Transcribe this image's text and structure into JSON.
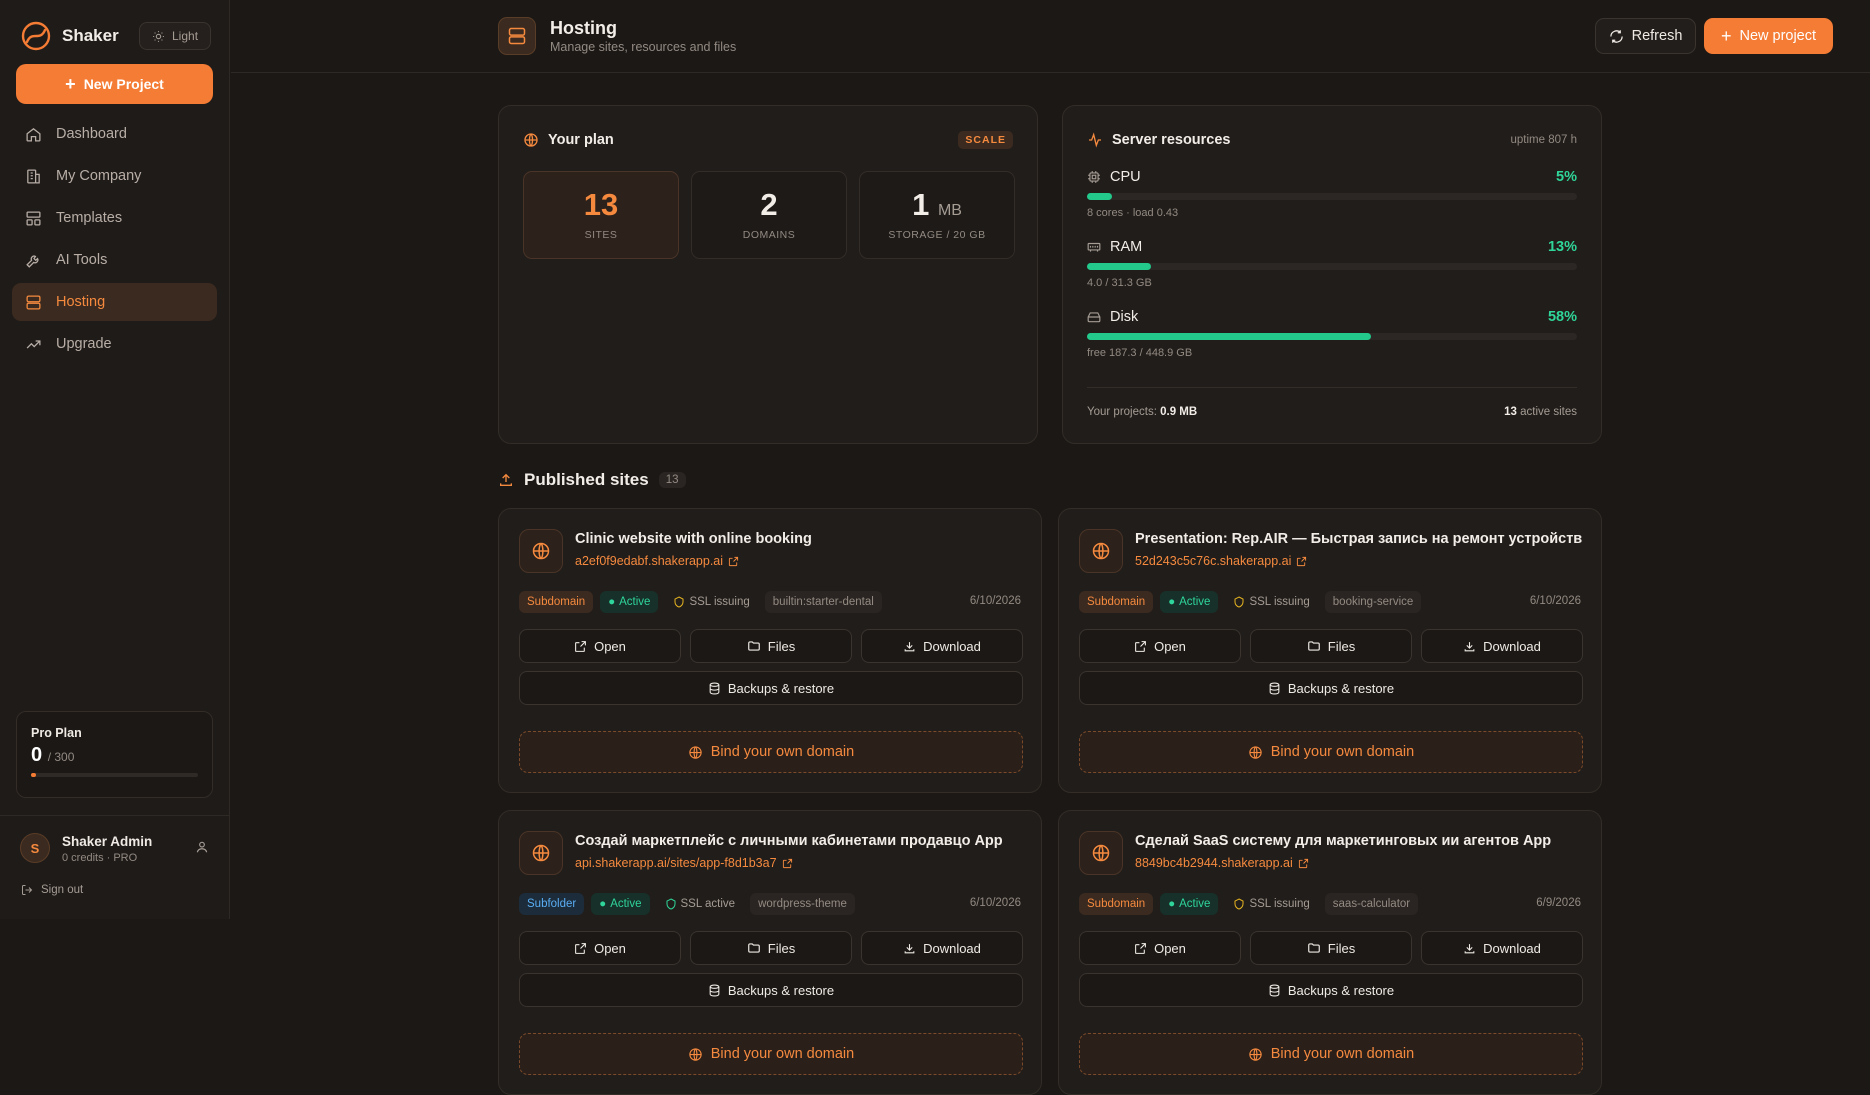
{
  "brand": {
    "name": "Shaker",
    "theme_label": "Light"
  },
  "sidebar": {
    "new_project": "New Project",
    "items": [
      {
        "label": "Dashboard",
        "icon": "home-icon"
      },
      {
        "label": "My Company",
        "icon": "building-icon"
      },
      {
        "label": "Templates",
        "icon": "layout-icon"
      },
      {
        "label": "AI Tools",
        "icon": "wrench-icon"
      },
      {
        "label": "Hosting",
        "icon": "server-icon",
        "active": true
      },
      {
        "label": "Upgrade",
        "icon": "trending-up-icon"
      }
    ],
    "plan": {
      "title": "Pro Plan",
      "used": "0",
      "max": "/ 300",
      "progress": 0
    },
    "user": {
      "initial": "S",
      "name": "Shaker Admin",
      "sub": "0 credits · PRO",
      "sign_out": "Sign out"
    }
  },
  "header": {
    "title": "Hosting",
    "subtitle": "Manage sites, resources and files",
    "refresh": "Refresh",
    "new_project": "New project"
  },
  "plan_card": {
    "title": "Your plan",
    "badge": "SCALE",
    "stats": [
      {
        "value": "13",
        "unit": "",
        "label": "SITES"
      },
      {
        "value": "2",
        "unit": "",
        "label": "DOMAINS"
      },
      {
        "value": "1",
        "unit": "MB",
        "label": "STORAGE / 20 GB"
      }
    ]
  },
  "resources": {
    "title": "Server resources",
    "uptime": "uptime 807 h",
    "items": [
      {
        "name": "CPU",
        "pct": "5%",
        "value": 5,
        "sub": "8 cores · load 0.43",
        "icon": "cpu-icon"
      },
      {
        "name": "RAM",
        "pct": "13%",
        "value": 13,
        "sub": "4.0 / 31.3 GB",
        "icon": "memory-icon"
      },
      {
        "name": "Disk",
        "pct": "58%",
        "value": 58,
        "sub": "free 187.3 / 448.9 GB",
        "icon": "hard-drive-icon"
      }
    ],
    "footer_left_label": "Your projects:",
    "footer_left_value": "0.9 MB",
    "footer_right_value": "13",
    "footer_right_label": "active sites"
  },
  "published": {
    "title": "Published sites",
    "count": "13"
  },
  "sites": [
    {
      "title": "Clinic website with online booking",
      "url": "a2ef0f9edabf.shakerapp.ai",
      "type": "Subdomain",
      "status": "Active",
      "ssl": "SSL issuing",
      "template": "builtin:starter-dental",
      "date": "6/10/2026"
    },
    {
      "title": "Presentation: Rep.AIR — Быстрая запись на ремонт устройств",
      "url": "52d243c5c76c.shakerapp.ai",
      "type": "Subdomain",
      "status": "Active",
      "ssl": "SSL issuing",
      "template": "booking-service",
      "date": "6/10/2026"
    },
    {
      "title": "Создай маркетплейс с личными кабинетами продавцо App",
      "url": "api.shakerapp.ai/sites/app-f8d1b3a7",
      "type": "Subfolder",
      "status": "Active",
      "ssl": "SSL active",
      "template": "wordpress-theme",
      "date": "6/10/2026"
    },
    {
      "title": "Сделай SaaS систему для маркетинговых ии агентов App",
      "url": "8849bc4b2944.shakerapp.ai",
      "type": "Subdomain",
      "status": "Active",
      "ssl": "SSL issuing",
      "template": "saas-calculator",
      "date": "6/9/2026"
    }
  ],
  "site_actions": {
    "open": "Open",
    "files": "Files",
    "download": "Download",
    "backups": "Backups & restore",
    "bind": "Bind your own domain"
  },
  "colors": {
    "accent": "#f47c34",
    "success": "#22c98b",
    "bg": "#1b1816"
  }
}
